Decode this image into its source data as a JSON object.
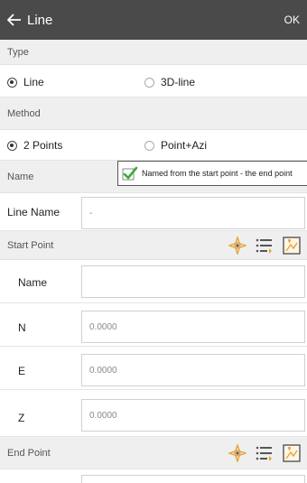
{
  "header": {
    "title": "Line",
    "ok_label": "OK",
    "back_icon": "back-arrow-icon"
  },
  "type_section": {
    "label": "Type",
    "options": [
      "Line",
      "3D-line"
    ],
    "selected": "Line"
  },
  "method_section": {
    "label": "Method",
    "options": [
      "2 Points",
      "Point+Azi"
    ],
    "selected": "2 Points"
  },
  "name_row": {
    "label": "Name",
    "checkbox_label": "Named from the start point - the end point",
    "checked": true
  },
  "line_name": {
    "label": "Line Name",
    "value": "-"
  },
  "start_point": {
    "label": "Start Point",
    "fields": [
      {
        "label": "Name",
        "value": ""
      },
      {
        "label": "N",
        "value": "0.0000"
      },
      {
        "label": "E",
        "value": "0.0000"
      },
      {
        "label": "Z",
        "value": "0.0000"
      }
    ]
  },
  "end_point": {
    "label": "End Point"
  },
  "colors": {
    "topbar": "#4a4a4a",
    "section_bg": "#efefef",
    "check_green": "#3aaa3a",
    "icon_orange": "#e8a23a"
  }
}
